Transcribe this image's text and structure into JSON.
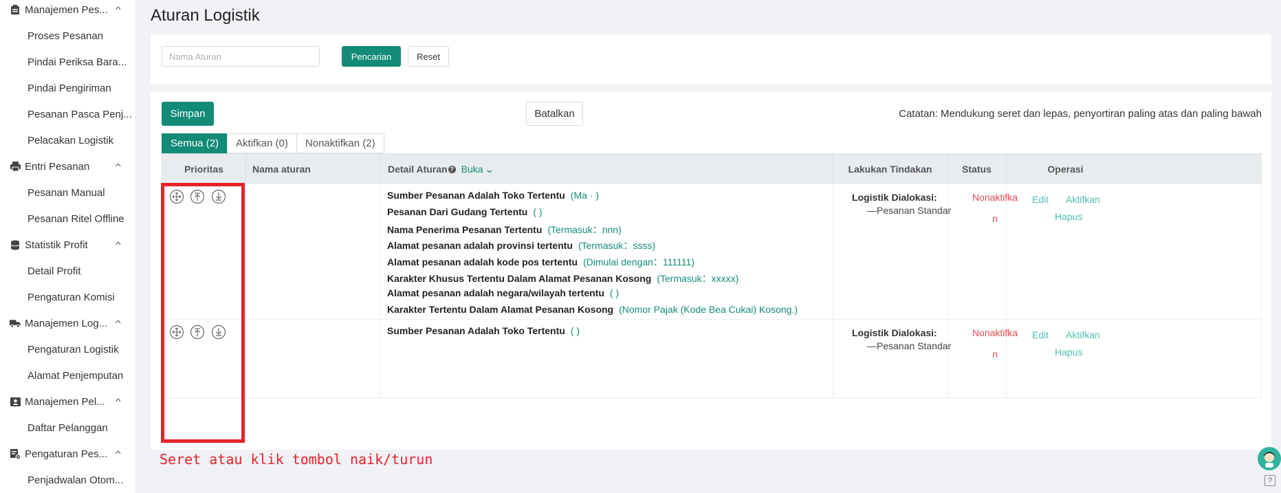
{
  "sidebar": {
    "groups": [
      {
        "label": "Manajemen Pes...",
        "icon": "clipboard-icon",
        "items": [
          "Proses Pesanan",
          "Pindai Periksa Bara...",
          "Pindai Pengiriman",
          "Pesanan Pasca Penj...",
          "Pelacakan Logistik"
        ]
      },
      {
        "label": "Entri Pesanan",
        "icon": "printer-icon",
        "items": [
          "Pesanan Manual",
          "Pesanan Ritel Offline"
        ]
      },
      {
        "label": "Statistik Profit",
        "icon": "database-icon",
        "items": [
          "Detail Profit",
          "Pengaturan Komisi"
        ]
      },
      {
        "label": "Manajemen Log...",
        "icon": "truck-icon",
        "items": [
          "Pengaturan Logistik",
          "Alamat Penjemputan"
        ]
      },
      {
        "label": "Manajemen Pel...",
        "icon": "id-card-icon",
        "items": [
          "Daftar Pelanggan"
        ]
      },
      {
        "label": "Pengaturan Pes...",
        "icon": "settings-doc-icon",
        "items": [
          "Penjadwalan Otom..."
        ]
      }
    ]
  },
  "page": {
    "title": "Aturan Logistik"
  },
  "search": {
    "placeholder": "Nama Aturan",
    "search_label": "Pencarian",
    "reset_label": "Reset"
  },
  "toolbar": {
    "save_label": "Simpan",
    "cancel_label": "Batalkan",
    "note": "Catatan: Mendukung seret dan lepas, penyortiran paling atas dan paling bawah"
  },
  "tabs": [
    {
      "label": "Semua (2)",
      "active": true
    },
    {
      "label": "Aktifkan (0)",
      "active": false
    },
    {
      "label": "Nonaktifkan (2)",
      "active": false
    }
  ],
  "table": {
    "headers": {
      "priority": "Prioritas",
      "name": "Nama aturan",
      "detail": "Detail Aturan",
      "open": "Buka",
      "action": "Lakukan Tindakan",
      "status": "Status",
      "operation": "Operasi"
    },
    "rows": [
      {
        "name": "",
        "details": [
          {
            "label": "Sumber Pesanan Adalah Toko Tertentu",
            "cond": "(Ma     ·     )"
          },
          {
            "label": "Pesanan Dari Gudang Tertentu",
            "cond": "(                )"
          },
          {
            "label": "Nama Penerima Pesanan Tertentu",
            "cond": "(Termasuk：nnn)"
          },
          {
            "label": "Alamat pesanan adalah provinsi tertentu",
            "cond": "(Termasuk：ssss)"
          },
          {
            "label": "Alamat pesanan adalah kode pos tertentu",
            "cond": "(Dimulai dengan：111111)"
          },
          {
            "label": "Karakter Khusus Tertentu Dalam Alamat Pesanan Kosong",
            "cond": "(Termasuk：xxxxx)"
          },
          {
            "label": "Alamat pesanan adalah negara/wilayah tertentu",
            "cond": "(                )"
          },
          {
            "label": "Karakter Tertentu Dalam Alamat Pesanan Kosong",
            "cond": "(Nomor Pajak (Kode Bea Cukai) Kosong.)"
          }
        ],
        "action_label": "Logistik Dialokasi:",
        "action_value": "—Pesanan Standar",
        "status_line1": "Nonaktifka",
        "status_line2": "n",
        "ops": {
          "edit": "Edit",
          "activate": "Aktifkan",
          "delete": "Hapus"
        }
      },
      {
        "name": "",
        "details": [
          {
            "label": "Sumber Pesanan Adalah Toko Tertentu",
            "cond": "(          )"
          }
        ],
        "action_label": "Logistik Dialokasi:",
        "action_value": "—Pesanan Standar",
        "status_line1": "Nonaktifka",
        "status_line2": "n",
        "ops": {
          "edit": "Edit",
          "activate": "Aktifkan",
          "delete": "Hapus"
        }
      }
    ]
  },
  "annotation": {
    "hint": "Seret atau klik tombol naik/turun"
  },
  "colors": {
    "primary": "#128b77",
    "link": "#4fbfad",
    "danger": "#e5484d",
    "highlight": "#e52329"
  }
}
